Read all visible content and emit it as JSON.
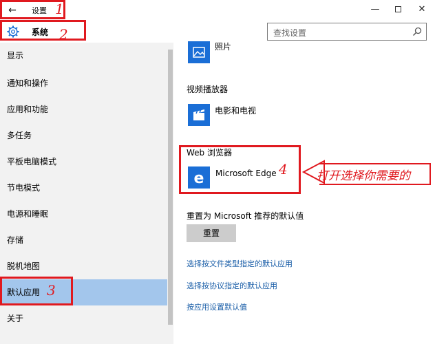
{
  "window": {
    "back_glyph": "←",
    "title": "设置",
    "minimize_glyph": "—",
    "close_glyph": "✕"
  },
  "header": {
    "title": "系统",
    "search_placeholder": "查找设置"
  },
  "sidebar": {
    "items": [
      {
        "label": "显示",
        "selected": false
      },
      {
        "label": "通知和操作",
        "selected": false
      },
      {
        "label": "应用和功能",
        "selected": false
      },
      {
        "label": "多任务",
        "selected": false
      },
      {
        "label": "平板电脑模式",
        "selected": false
      },
      {
        "label": "节电模式",
        "selected": false
      },
      {
        "label": "电源和睡眠",
        "selected": false
      },
      {
        "label": "存储",
        "selected": false
      },
      {
        "label": "脱机地图",
        "selected": false
      },
      {
        "label": "默认应用",
        "selected": true
      },
      {
        "label": "关于",
        "selected": false
      }
    ]
  },
  "content": {
    "photo_app": {
      "name": "照片",
      "icon": "photos-icon"
    },
    "video_section": "视频播放器",
    "video_app": {
      "name": "电影和电视",
      "icon": "movies-tv-icon"
    },
    "browser_section": "Web 浏览器",
    "browser_app": {
      "name": "Microsoft Edge",
      "icon": "edge-icon"
    },
    "reset_label": "重置为 Microsoft 推荐的默认值",
    "reset_button": "重置",
    "links": [
      "选择按文件类型指定的默认应用",
      "选择按协议指定的默认应用",
      "按应用设置默认值"
    ]
  },
  "annotations": {
    "numbers": [
      "1",
      "2",
      "3",
      "4"
    ],
    "callout": "打开选择你需要的",
    "color": "#e0191f"
  },
  "colors": {
    "accent_tile": "#1a6ed6",
    "selected_nav": "#a3c6ec",
    "sidebar_bg": "#f2f2f2",
    "link": "#1a5ea8"
  }
}
